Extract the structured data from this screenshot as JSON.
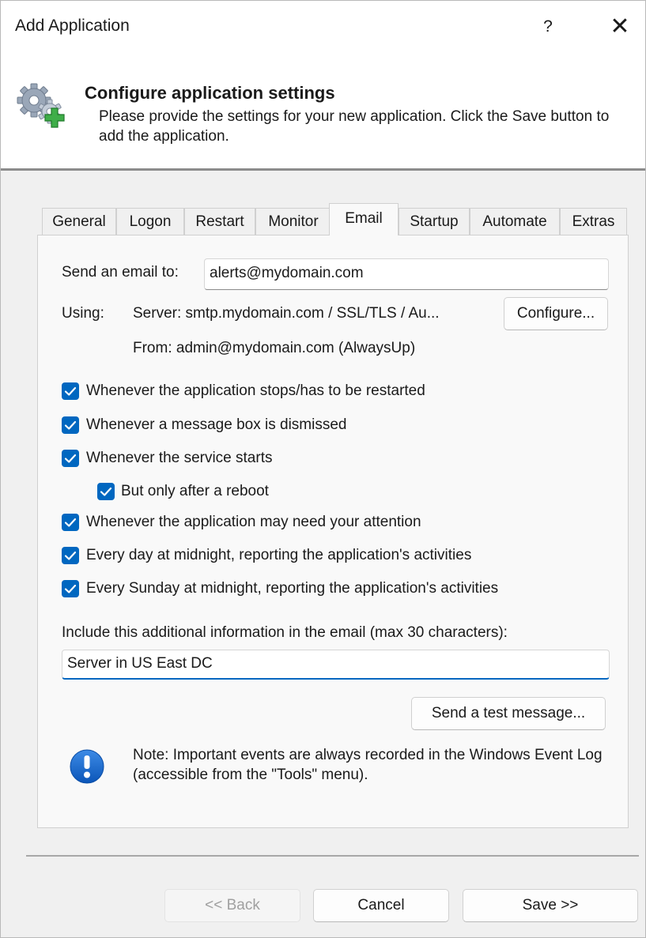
{
  "window": {
    "title": "Add Application",
    "help_label": "?",
    "close_label": "✕"
  },
  "header": {
    "title": "Configure application settings",
    "subtitle": "Please provide the settings for your new application. Click the Save button to add the application.",
    "icon": "gear-add-icon"
  },
  "tabs": [
    {
      "label": "General",
      "active": false
    },
    {
      "label": "Logon",
      "active": false
    },
    {
      "label": "Restart",
      "active": false
    },
    {
      "label": "Monitor",
      "active": false
    },
    {
      "label": "Email",
      "active": true
    },
    {
      "label": "Startup",
      "active": false
    },
    {
      "label": "Automate",
      "active": false
    },
    {
      "label": "Extras",
      "active": false
    }
  ],
  "email": {
    "send_to_label": "Send an email to:",
    "send_to_value": "alerts@mydomain.com",
    "using_label": "Using:",
    "server_text": "Server: smtp.mydomain.com / SSL/TLS / Au...",
    "from_text": "From: admin@mydomain.com (AlwaysUp)",
    "configure_label": "Configure...",
    "checkboxes": [
      {
        "label": "Whenever the application stops/has to be restarted",
        "checked": true
      },
      {
        "label": "Whenever a message box is dismissed",
        "checked": true
      },
      {
        "label": "Whenever the service starts",
        "checked": true
      },
      {
        "label": "But only after a reboot",
        "checked": true
      },
      {
        "label": "Whenever the application may need your attention",
        "checked": true
      },
      {
        "label": "Every day at midnight, reporting the application's activities",
        "checked": true
      },
      {
        "label": "Every Sunday at midnight, reporting the application's activities",
        "checked": true
      }
    ],
    "additional_info_label": "Include this additional information in the email (max 30 characters):",
    "additional_info_value": "Server in US East DC",
    "test_button_label": "Send a test message...",
    "note_text": "Note: Important events are always recorded in the Windows Event Log (accessible from the \"Tools\" menu).",
    "note_icon": "info-exclamation-icon"
  },
  "footer": {
    "back_label": "<< Back",
    "back_disabled": true,
    "cancel_label": "Cancel",
    "save_label": "Save >>"
  },
  "colors": {
    "accent": "#0067c0",
    "window_bg": "#f0f0f0",
    "panel_bg": "#f9f9f9"
  }
}
